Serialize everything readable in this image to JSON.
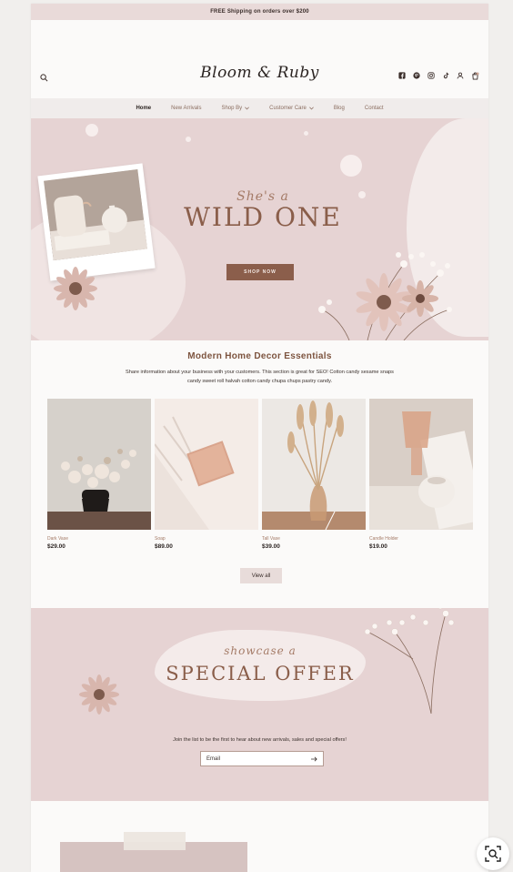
{
  "announcement": "FREE Shipping on orders over $200",
  "brand": {
    "logo_text": "Bloom & Ruby"
  },
  "header_icons": [
    "facebook-icon",
    "pinterest-icon",
    "instagram-icon",
    "tiktok-icon",
    "account-icon",
    "cart-icon"
  ],
  "nav": {
    "items": [
      {
        "label": "Home",
        "active": true,
        "dropdown": false
      },
      {
        "label": "New Arrivals",
        "active": false,
        "dropdown": false
      },
      {
        "label": "Shop By",
        "active": false,
        "dropdown": true
      },
      {
        "label": "Customer Care",
        "active": false,
        "dropdown": true
      },
      {
        "label": "Blog",
        "active": false,
        "dropdown": false
      },
      {
        "label": "Contact",
        "active": false,
        "dropdown": false
      }
    ]
  },
  "hero": {
    "script_text": "She's a",
    "title": "WILD ONE",
    "button_label": "SHOP NOW"
  },
  "featured": {
    "title": "Modern Home Decor Essentials",
    "description_line1": "Share information about your business with your customers. This section is great for SEO! Cotton candy sesame snaps",
    "description_line2": "candy sweet roll halvah cotton candy chupa chups pastry candy.",
    "products": [
      {
        "name": "Dark Vase",
        "price": "$29.00"
      },
      {
        "name": "Soap",
        "price": "$89.00"
      },
      {
        "name": "Tall Vase",
        "price": "$39.00"
      },
      {
        "name": "Candle Holder",
        "price": "$19.00"
      }
    ],
    "view_all_label": "View all"
  },
  "offer": {
    "script_text": "showcase a",
    "title": "SPECIAL OFFER",
    "join_text": "Join the list to be the first to hear about new arrivals, sales and special offers!",
    "email_placeholder": "Email"
  },
  "colors": {
    "blush": "#e6d3d3",
    "brown_accent": "#8b5e4b",
    "text_accent": "#a47a66"
  }
}
